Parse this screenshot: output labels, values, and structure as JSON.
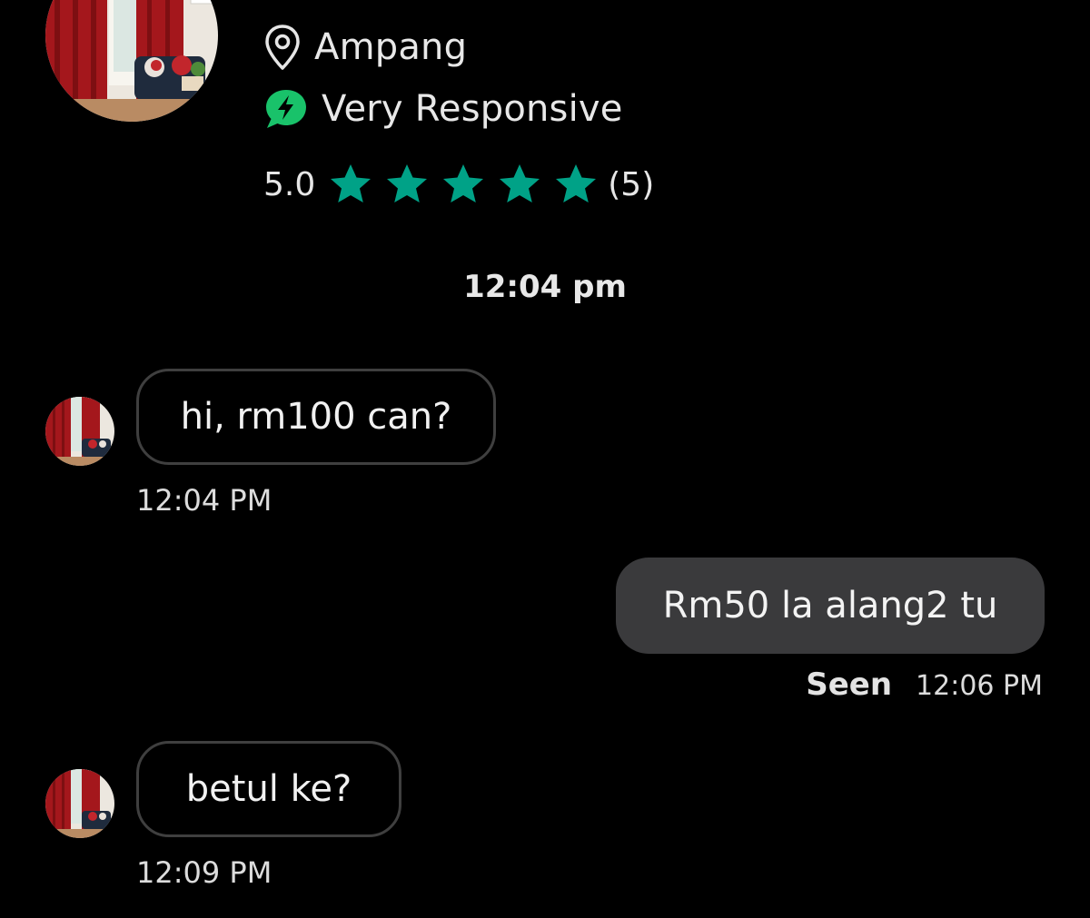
{
  "profile": {
    "location": "Ampang",
    "location_icon": "map-pin-icon",
    "responsiveness": "Very Responsive",
    "responsiveness_icon": "lightning-bolt-icon",
    "rating_value": "5.0",
    "rating": 5,
    "rating_max": 5,
    "rating_count": "(5)",
    "colors": {
      "star": "#00a287",
      "responsive_badge": "#19c26a"
    }
  },
  "chat": {
    "date_divider": "12:04 pm",
    "messages": [
      {
        "direction": "incoming",
        "text": "hi, rm100 can?",
        "time": "12:04 PM"
      },
      {
        "direction": "outgoing",
        "text": "Rm50 la alang2 tu",
        "status": "Seen",
        "time": "12:06 PM"
      },
      {
        "direction": "incoming",
        "text": "betul ke?",
        "time": "12:09 PM"
      }
    ]
  },
  "theme": {
    "background": "#000000",
    "outgoing_bubble": "#3a3a3c",
    "incoming_border": "#3f3f3f"
  }
}
